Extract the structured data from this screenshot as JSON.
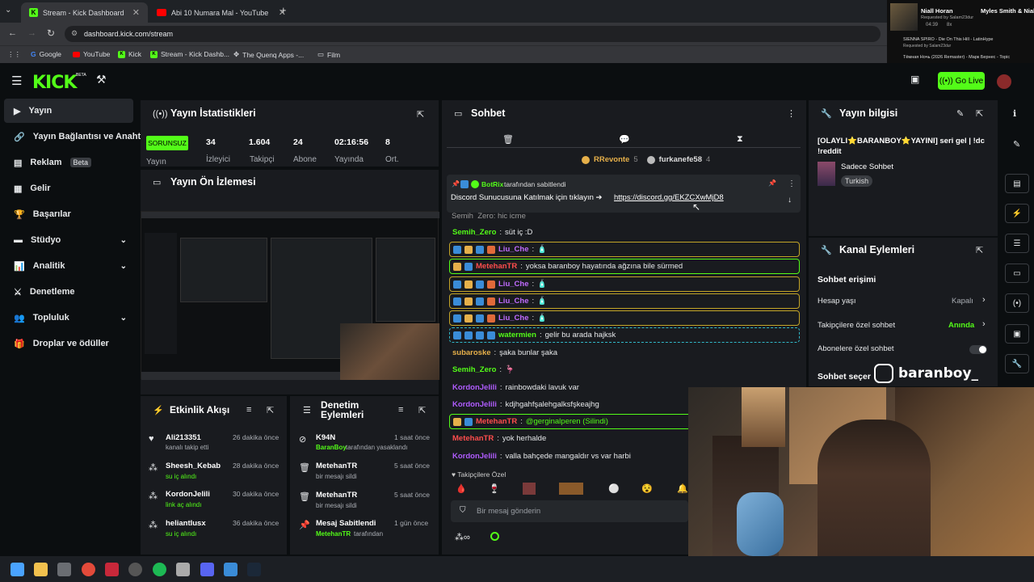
{
  "browser": {
    "tabs": [
      {
        "title": "Stream - Kick Dashboard",
        "active": true
      },
      {
        "title": "Abi 10 Numara Mal - YouTube",
        "active": false
      }
    ],
    "url": "dashboard.kick.com/stream",
    "bookmarks": [
      "Google",
      "YouTube",
      "Kick",
      "Stream - Kick Dashb...",
      "The Quenq Apps -...",
      "Film"
    ]
  },
  "youtube_mini": {
    "song1_artist": "Niall Horan",
    "song1_right": "Myles Smith & Nial",
    "song1_req": "Requested by Salam23dur",
    "song1_time": "04:39",
    "song1_count": "8x",
    "song2": "SIENNA SPIRO - Die On This Hill - LatinHype",
    "song2_req": "Requested by Salam23dur",
    "song3": "Тёмная Ночь (2026 Remaster) - Марк Бернес - Topic"
  },
  "header": {
    "go_live": "Go Live"
  },
  "sidebar": {
    "items": [
      {
        "label": "Yayın"
      },
      {
        "label": "Yayın Bağlantısı ve Anahtarı"
      },
      {
        "label": "Reklam",
        "badge": "Beta"
      },
      {
        "label": "Gelir"
      },
      {
        "label": "Başarılar"
      },
      {
        "label": "Stüdyo"
      },
      {
        "label": "Analitik"
      },
      {
        "label": "Denetleme"
      },
      {
        "label": "Topluluk"
      },
      {
        "label": "Droplar ve ödüller"
      }
    ]
  },
  "stats": {
    "title": "Yayın İstatistikleri",
    "status": "SORUNSUZ",
    "status_label": "Yayın",
    "items": [
      {
        "value": "34",
        "label": "İzleyici"
      },
      {
        "value": "1.604",
        "label": "Takipçi"
      },
      {
        "value": "24",
        "label": "Abone"
      },
      {
        "value": "02:16:56",
        "label": "Yayında"
      },
      {
        "value": "8",
        "label": "Ort."
      }
    ]
  },
  "preview": {
    "title": "Yayın Ön İzlemesi"
  },
  "activity": {
    "title": "Etkinlik Akışı",
    "events": [
      {
        "name": "Ali213351",
        "sub": "kanalı takip etti",
        "time": "26 dakika önce"
      },
      {
        "name": "Sheesh_Kebab",
        "sub": "su iç alındı",
        "time": "28 dakika önce"
      },
      {
        "name": "KordonJelili",
        "sub": "link aç alındı",
        "time": "30 dakika önce"
      },
      {
        "name": "heliantlusx",
        "sub": "su iç alındı",
        "time": "36 dakika önce"
      }
    ]
  },
  "moderation": {
    "title1": "Denetim",
    "title2": "Eylemleri",
    "events": [
      {
        "name": "K94N",
        "sub_user": "BaranBoy",
        "sub": "tarafından yasaklandı",
        "time": "1 saat önce"
      },
      {
        "name": "MetehanTR",
        "sub_user": "",
        "sub": "bir mesajı sildi",
        "time": "5 saat önce"
      },
      {
        "name": "MetehanTR",
        "sub_user": "",
        "sub": "bir mesajı sildi",
        "time": "5 saat önce"
      },
      {
        "name": "Mesaj Sabitlendi",
        "sub_user": "MetehanTR",
        "sub": "tarafından",
        "time": "1 gün önce"
      }
    ]
  },
  "chat": {
    "title": "Sohbet",
    "leaders": [
      {
        "name": "RRevonte",
        "count": "5"
      },
      {
        "name": "furkanefe58",
        "count": "4"
      }
    ],
    "pinned_by": "BotRix",
    "pinned_by_suffix": "tarafından sabitlendi",
    "pinned_text": "Discord Sunucusuna Katılmak için tıklayın ➔",
    "pinned_link": "https://discord.gg/EKZCXwMjD8",
    "partial": "Semih_Zero: hiç içme",
    "messages": [
      {
        "user": "Semih_Zero",
        "color": "#53fc18",
        "text": "süt iç :D",
        "style": ""
      },
      {
        "user": "Liu_Che",
        "color": "#c06bff",
        "text": "🧴",
        "style": "hl"
      },
      {
        "user": "MetehanTR",
        "color": "#ff4d4d",
        "text": "yoksa baranboy hayatında ağzına bile sürmed",
        "style": "hlg"
      },
      {
        "user": "Liu_Che",
        "color": "#c06bff",
        "text": "🧴",
        "style": "hl"
      },
      {
        "user": "Liu_Che",
        "color": "#c06bff",
        "text": "🧴",
        "style": "hl"
      },
      {
        "user": "Liu_Che",
        "color": "#c06bff",
        "text": "🧴",
        "style": "hl"
      },
      {
        "user": "watermien",
        "color": "#53fc18",
        "text": "gelir bu arada hajksk",
        "style": "hlb"
      },
      {
        "user": "subaroske",
        "color": "#e6b04a",
        "text": "şaka bunlar şaka",
        "style": ""
      },
      {
        "user": "Semih_Zero",
        "color": "#53fc18",
        "text": "🦩",
        "style": ""
      },
      {
        "user": "KordonJelili",
        "color": "#b05cff",
        "text": "rainbowdaki lavuk var",
        "style": ""
      },
      {
        "user": "KordonJelili",
        "color": "#b05cff",
        "text": "kdjhgahfşalehgalksfşkeajhg",
        "style": ""
      },
      {
        "user": "MetehanTR",
        "color": "#ff4d4d",
        "text": "@gerginalperen (Silindi)",
        "style": "hlg"
      },
      {
        "user": "MetehanTR",
        "color": "#ff4d4d",
        "text": "yok herhalde",
        "style": ""
      },
      {
        "user": "KordonJelili",
        "color": "#b05cff",
        "text": "valla bahçede mangaldır vs var harbi",
        "style": ""
      }
    ],
    "followers_only": "♥ Takipçilere Özel",
    "input_placeholder": "Bir mesaj gönderin"
  },
  "stream_info": {
    "title": "Yayın bilgisi",
    "stream_title": "[OLAYLI⭐BARANBOY⭐YAYINI] seri gel | !dc !reddit",
    "category": "Sadece Sohbet",
    "language": "Turkish"
  },
  "channel_actions": {
    "title": "Kanal Eylemleri",
    "section": "Sohbet erişimi",
    "rows": [
      {
        "label": "Hesap yaşı",
        "value": "Kapalı"
      },
      {
        "label": "Takipçilere özel sohbet",
        "value": "Anında"
      },
      {
        "label": "Abonelere özel sohbet",
        "value": ""
      }
    ],
    "next": "Sohbet seçer"
  },
  "overlay": {
    "handle": "baranboy_"
  },
  "colors": {
    "brand": "#53fc18",
    "panel": "#191b1f",
    "bg": "#0b0e10"
  }
}
